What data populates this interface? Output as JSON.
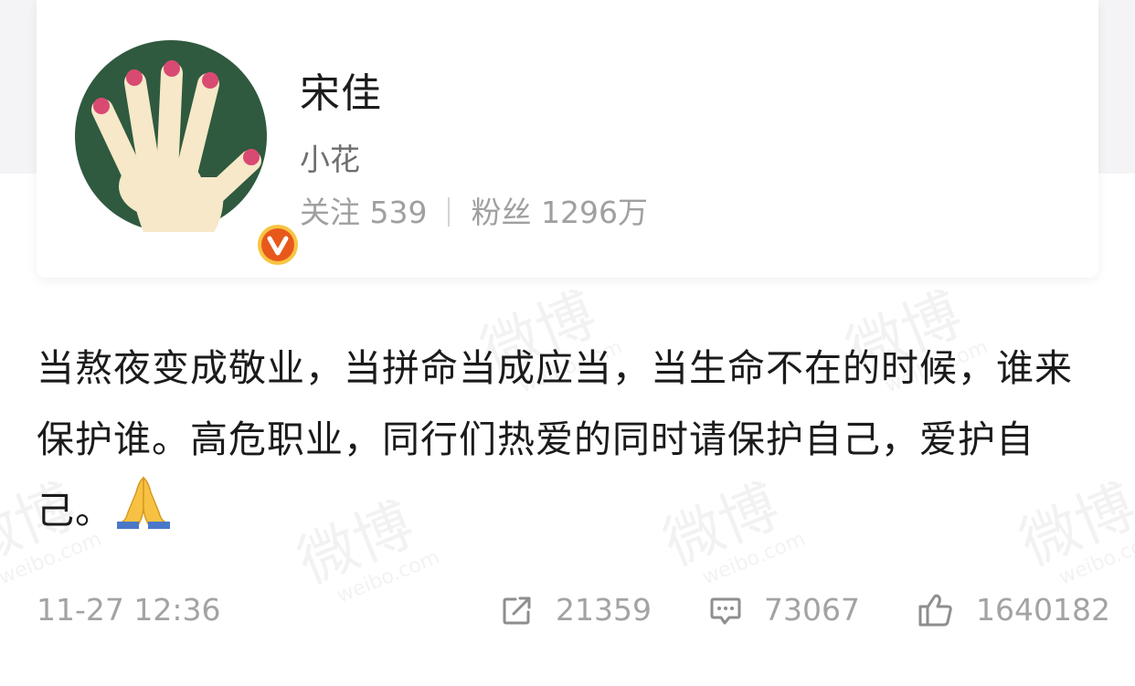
{
  "profile": {
    "name": "宋佳",
    "subtitle": "小花",
    "following_label": "关注",
    "following_count": "539",
    "followers_label": "粉丝",
    "followers_count": "1296万"
  },
  "post": {
    "text": "当熬夜变成敬业，当拼命当成应当，当生命不在的时候，谁来保护谁。高危职业，同行们热爱的同时请保护自己，爱护自己。",
    "time": "11-27 12:36",
    "reposts": "21359",
    "comments": "73067",
    "likes": "1640182"
  },
  "watermark": {
    "brand": "微博",
    "domain": "weibo.com"
  },
  "icons": {
    "avatar": "hand-icon",
    "verified": "verified-v-icon",
    "emoji": "folded-hands-icon",
    "repost": "repost-icon",
    "comment": "comment-icon",
    "like": "thumbs-up-icon"
  },
  "colors": {
    "avatar_bg": "#2f5a3f",
    "nail": "#d94a73",
    "badge": "#e8581c",
    "badge_ring": "#f7c542",
    "text_primary": "#1b1b1b",
    "text_secondary": "#a0a0a0"
  }
}
